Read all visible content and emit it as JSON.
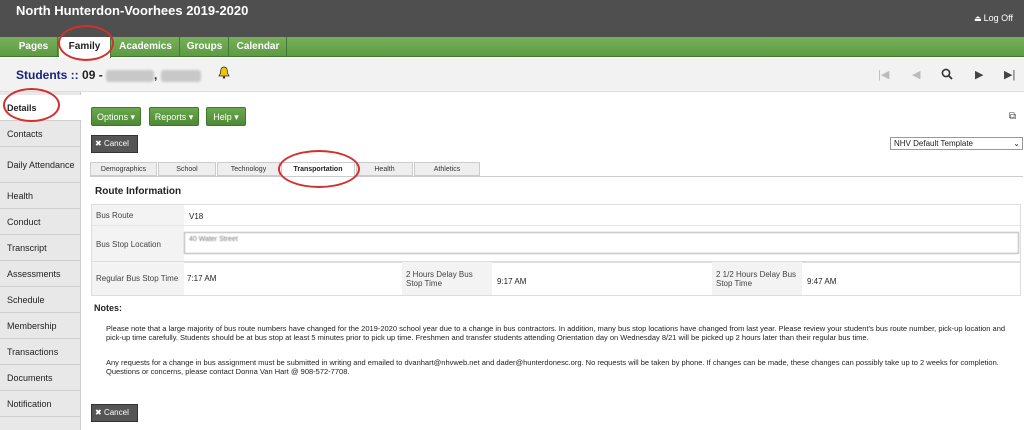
{
  "header": {
    "title": "North Hunterdon-Voorhees 2019-2020",
    "logoff_label": "Log Off"
  },
  "topnav": {
    "tabs": [
      "Pages",
      "Family",
      "Academics",
      "Groups",
      "Calendar"
    ],
    "active": "Family"
  },
  "student": {
    "prefix": "Students",
    "sep": " :: ",
    "id_text": "09 -",
    "comma": ","
  },
  "sidebar": {
    "items": [
      "Details",
      "Contacts",
      "Daily Attendance",
      "Health",
      "Conduct",
      "Transcript",
      "Assessments",
      "Schedule",
      "Membership",
      "Transactions",
      "Documents",
      "Notification"
    ],
    "active": "Details"
  },
  "toolbar": {
    "options_label": "Options",
    "reports_label": "Reports",
    "help_label": "Help",
    "cancel_label": "Cancel"
  },
  "template": {
    "selected": "NHV Default Template"
  },
  "subtabs": {
    "items": [
      "Demographics",
      "School",
      "Technology",
      "Transportation",
      "Health",
      "Athletics"
    ],
    "active": "Transportation"
  },
  "route": {
    "section_title": "Route Information",
    "bus_route_label": "Bus Route",
    "bus_route_value": "V18",
    "bus_stop_label": "Bus Stop Location",
    "bus_stop_value": "40 Water Street",
    "regular_time_label": "Regular Bus Stop Time",
    "regular_time_value": "7:17 AM",
    "delay2_label": "2 Hours Delay Bus Stop Time",
    "delay2_value": "9:17 AM",
    "delay25_label": "2 1/2 Hours Delay Bus Stop Time",
    "delay25_value": "9:47 AM"
  },
  "notes": {
    "label": "Notes:",
    "p1": "Please note that a large majority of bus route numbers have changed for the 2019-2020 school year due to a change in bus contractors. In addition, many bus stop locations have changed from last year. Please review your student's bus route number, pick-up location and pick-up time carefully. Students should be at bus stop at least 5 minutes prior to pick up time. Freshmen and transfer students attending Orientation day on Wednesday 8/21 will be picked up 2 hours later than their regular bus time.",
    "p2": "Any requests for a change in bus assignment must be submitted in writing and emailed to dvanhart@nhvweb.net and dader@hunterdonesc.org. No requests will be taken by phone. If changes can be made, these changes can possibly take up to 2 weeks for completion. Questions or concerns, please contact Donna Van Hart @ 908-572-7708."
  },
  "colors": {
    "nav_green": "#5d9a43",
    "header_gray": "#4f4f4f",
    "student_blue": "#1a237e",
    "annotation_red": "#d32f2f"
  }
}
